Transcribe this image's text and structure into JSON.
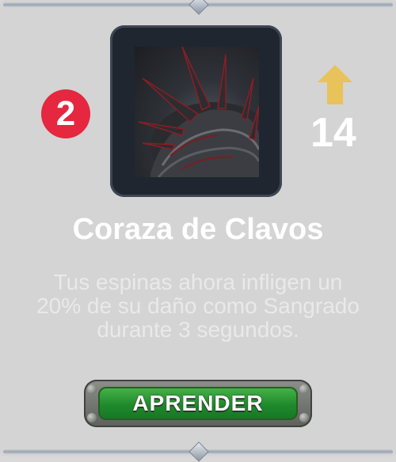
{
  "skill": {
    "rank": "2",
    "level": "14",
    "name": "Coraza de Clavos",
    "description": "Tus espinas ahora infligen un 20% de su daño como Sangrado durante 3 segundos."
  },
  "actions": {
    "learn_label": "APRENDER"
  },
  "icons": {
    "skill_icon": "spiked-armor-icon",
    "upgrade_icon": "up-arrow-icon"
  },
  "colors": {
    "rank_badge": "#e5273f",
    "upgrade_arrow": "#e8c25a",
    "button_green": "#2e9a36"
  }
}
